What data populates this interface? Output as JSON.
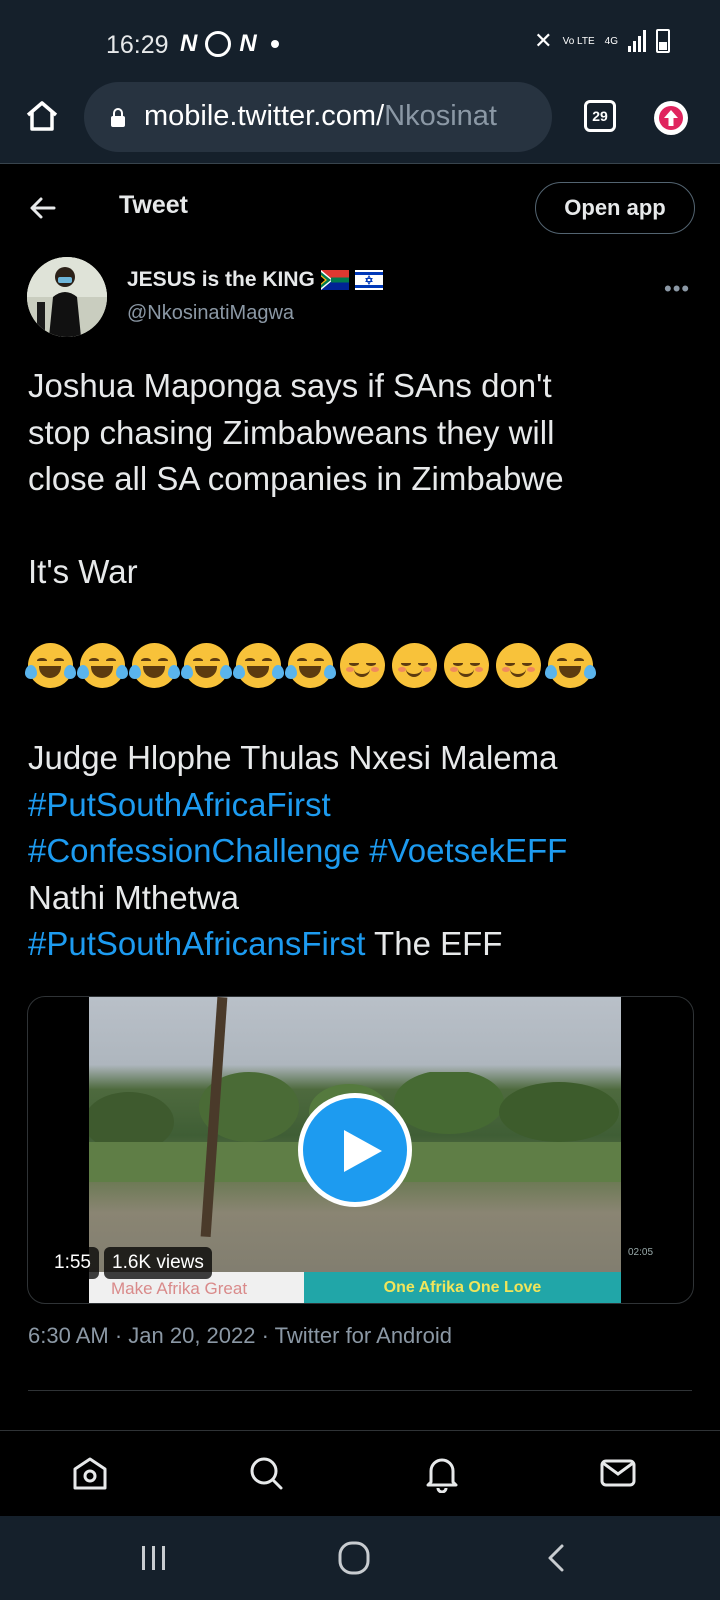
{
  "status_bar": {
    "time": "16:29",
    "network_label": "4G",
    "volte_label": "Vo LTE"
  },
  "browser": {
    "url_main": "mobile.twitter.com/",
    "url_path": "Nkosinat",
    "tab_count": "29"
  },
  "header": {
    "title": "Tweet",
    "open_app_label": "Open app"
  },
  "author": {
    "name": "JESUS is the KING",
    "handle": "@NkosinatiMagwa",
    "flags": [
      "south-africa-flag",
      "israel-flag"
    ]
  },
  "tweet": {
    "line1": "Joshua Maponga says if SAns don't",
    "line2": "stop chasing Zimbabweans they will",
    "line3": "close all SA companies in Zimbabwe",
    "line4": "It's War",
    "emojis": [
      "crying-laughing",
      "crying-laughing",
      "crying-laughing",
      "crying-laughing",
      "crying-laughing",
      "crying-laughing",
      "relieved",
      "relieved",
      "relieved",
      "relieved",
      "crying-laughing"
    ],
    "line5": "Judge Hlophe Thulas Nxesi Malema",
    "hashtag1": "#PutSouthAfricaFirst",
    "hashtag2": "#ConfessionChallenge",
    "hashtag3": "#VoetsekEFF",
    "line6": "Nathi Mthetwa",
    "hashtag4": "#PutSouthAfricansFirst",
    "line7_tail": " The EFF"
  },
  "video": {
    "duration": "1:55",
    "views": "1.6K views",
    "banner_left": "Make Afrika Great",
    "banner_right": "One Afrika One Love",
    "corner_time": "02:05"
  },
  "meta": {
    "time": "6:30 AM",
    "date": "Jan 20, 2022",
    "source": "Twitter for Android"
  },
  "colors": {
    "background": "#000000",
    "chrome": "#15202b",
    "link": "#1d9bf0",
    "secondary_text": "#8b98a5"
  },
  "bottom_nav": [
    "home-icon",
    "search-icon",
    "notifications-icon",
    "messages-icon"
  ],
  "system_nav": [
    "recent-apps-icon",
    "home-circle-icon",
    "back-chevron-icon"
  ]
}
